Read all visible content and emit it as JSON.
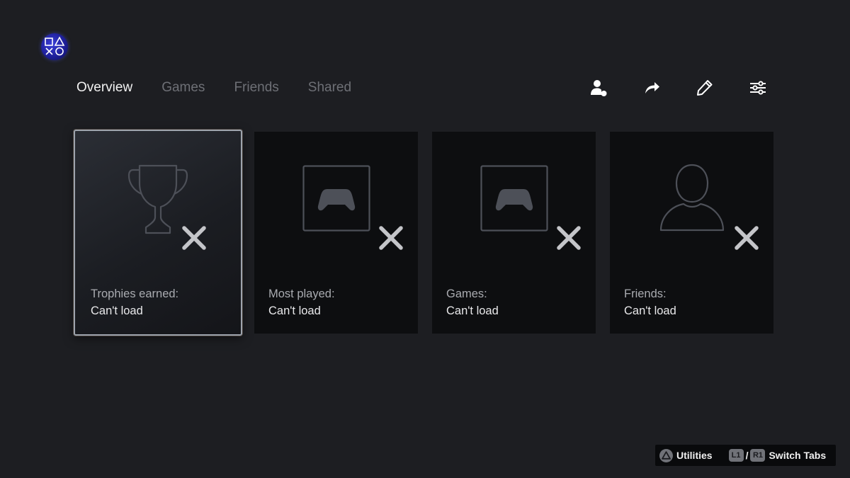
{
  "profile": {
    "avatar_icon": "playstation-shapes-avatar"
  },
  "tabs": [
    {
      "label": "Overview",
      "active": true
    },
    {
      "label": "Games",
      "active": false
    },
    {
      "label": "Friends",
      "active": false
    },
    {
      "label": "Shared",
      "active": false
    }
  ],
  "actions": [
    {
      "icon": "friend-request-icon"
    },
    {
      "icon": "share-icon"
    },
    {
      "icon": "edit-pencil-icon"
    },
    {
      "icon": "settings-sliders-icon"
    }
  ],
  "cards": [
    {
      "icon": "trophy-icon",
      "label": "Trophies earned:",
      "value": "Can't load",
      "focused": true
    },
    {
      "icon": "controller-icon",
      "label": "Most played:",
      "value": "Can't load",
      "focused": false
    },
    {
      "icon": "controller-icon",
      "label": "Games:",
      "value": "Can't load",
      "focused": false
    },
    {
      "icon": "person-icon",
      "label": "Friends:",
      "value": "Can't load",
      "focused": false
    }
  ],
  "hints": {
    "utilities_button_icon": "triangle-button-icon",
    "utilities_label": "Utilities",
    "l1_label": "L1",
    "separator": "/",
    "r1_label": "R1",
    "switch_label": "Switch Tabs"
  },
  "colors": {
    "background": "#1d1e22",
    "card_background": "#0d0e10",
    "tab_active": "#f2f2f2",
    "tab_inactive": "#6e7076",
    "error_x": "#c4c5c9"
  }
}
